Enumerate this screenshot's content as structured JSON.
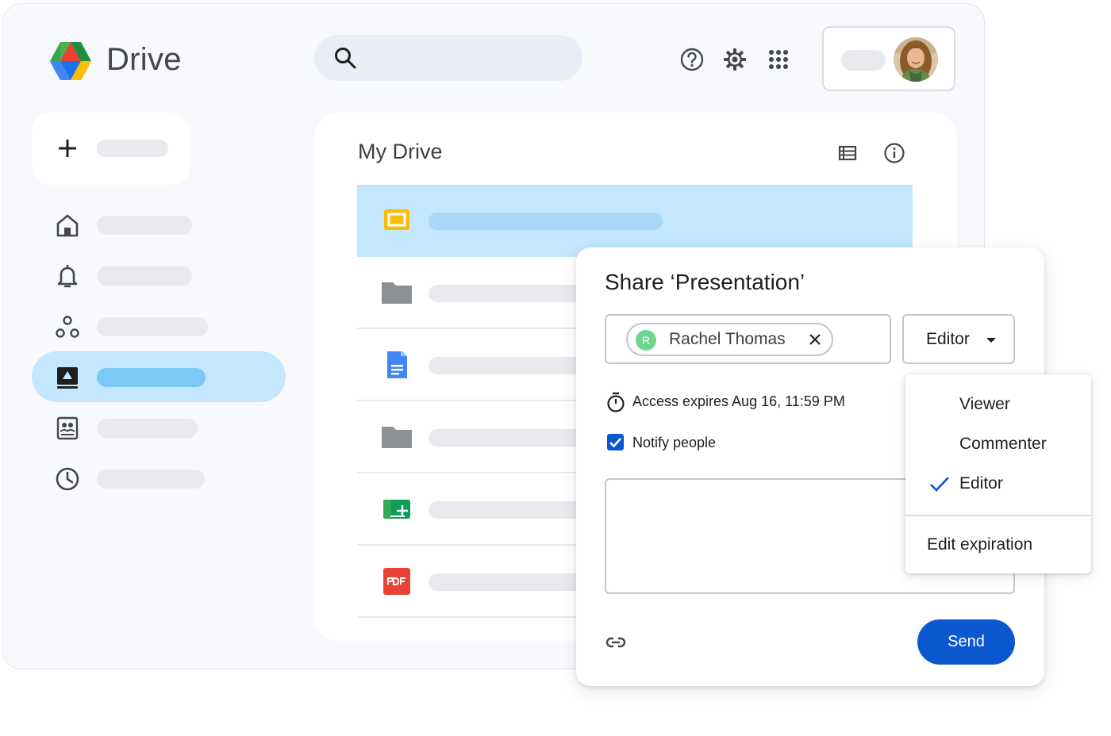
{
  "app": {
    "name": "Drive"
  },
  "main": {
    "title": "My Drive"
  },
  "share_dialog": {
    "title": "Share ‘Presentation’",
    "recipient": {
      "initial": "R",
      "name": "Rachel Thomas"
    },
    "role": "Editor",
    "access_expiry": "Access expires Aug 16, 11:59 PM",
    "notify_label": "Notify people",
    "notify_checked": true,
    "send_label": "Send"
  },
  "role_menu": {
    "items": [
      {
        "label": "Viewer",
        "selected": false
      },
      {
        "label": "Commenter",
        "selected": false
      },
      {
        "label": "Editor",
        "selected": true
      }
    ],
    "extra": "Edit expiration"
  },
  "icons": {
    "top_bar": [
      "help-icon",
      "settings-icon",
      "apps-grid-icon"
    ],
    "nav": [
      "home-icon",
      "notifications-icon",
      "shared-drives-icon",
      "my-drive-icon",
      "shared-with-me-icon",
      "recent-icon"
    ],
    "files": [
      "slides-file-icon",
      "folder-icon",
      "docs-file-icon",
      "folder-icon",
      "sheets-file-icon",
      "pdf-file-icon"
    ]
  },
  "colors": {
    "accent": "#0b57d0",
    "selected": "#c2e7ff"
  }
}
